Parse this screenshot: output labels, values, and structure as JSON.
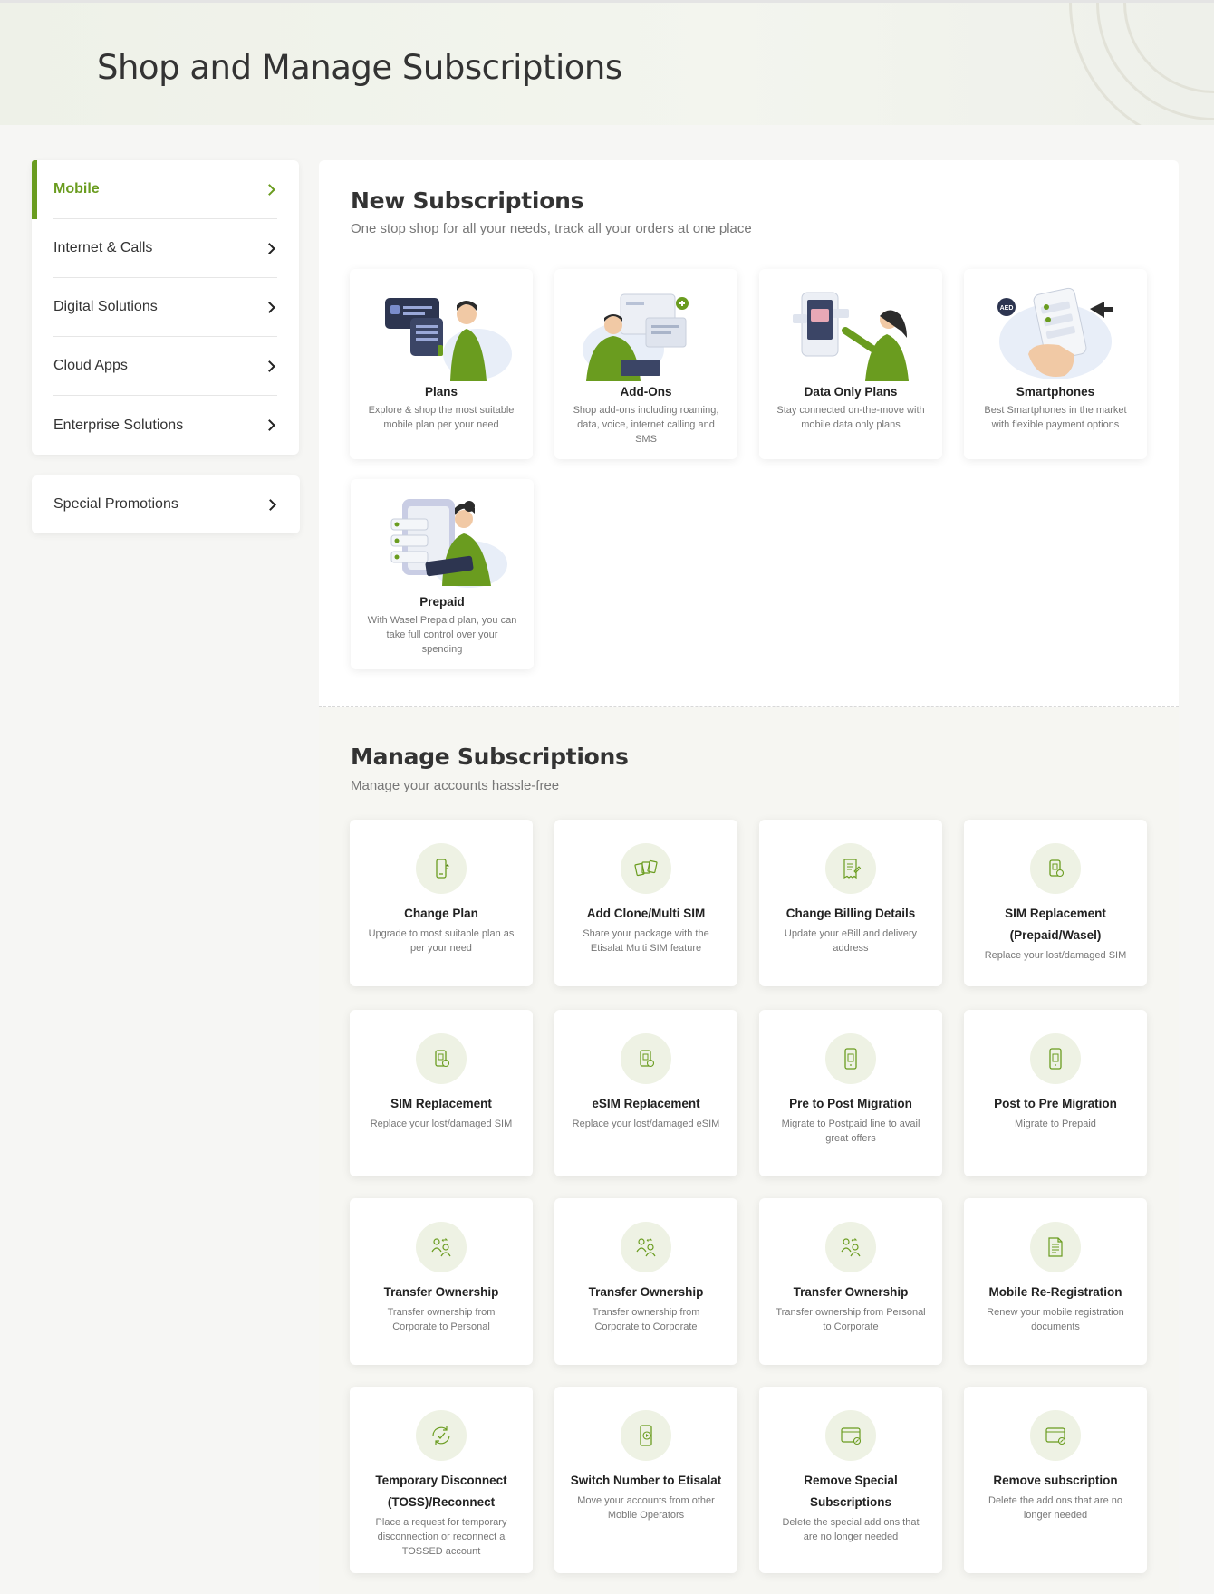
{
  "header": {
    "title": "Shop and Manage Subscriptions"
  },
  "sidebar": {
    "items": [
      {
        "label": "Mobile"
      },
      {
        "label": "Internet & Calls"
      },
      {
        "label": "Digital Solutions"
      },
      {
        "label": "Cloud Apps"
      },
      {
        "label": "Enterprise Solutions"
      }
    ],
    "promo": {
      "label": "Special Promotions"
    }
  },
  "new_subscriptions": {
    "title": "New Subscriptions",
    "subtitle": "One stop shop for all your needs, track all your orders at one place",
    "cards": [
      {
        "title": "Plans",
        "desc": "Explore & shop the most suitable mobile plan per your need",
        "icon": "plans-illustration"
      },
      {
        "title": "Add-Ons",
        "desc": "Shop add-ons including roaming, data, voice, internet calling and SMS",
        "icon": "addons-illustration"
      },
      {
        "title": "Data Only Plans",
        "desc": "Stay connected on-the-move with mobile data only plans",
        "icon": "data-plans-illustration"
      },
      {
        "title": "Smartphones",
        "desc": "Best Smartphones in the market with flexible payment options",
        "icon": "smartphones-illustration",
        "badge": "AED"
      },
      {
        "title": "Prepaid",
        "desc": "With Wasel Prepaid plan, you can take full control over your spending",
        "icon": "prepaid-illustration"
      }
    ]
  },
  "manage_subscriptions": {
    "title": "Manage Subscriptions",
    "subtitle": "Manage your accounts hassle-free",
    "cards": [
      {
        "title": "Change Plan",
        "desc": "Upgrade to most suitable plan as per your need",
        "icon": "phone-icon"
      },
      {
        "title": "Add Clone/Multi SIM",
        "desc": "Share your package with the Etisalat Multi SIM feature",
        "icon": "multi-sim-icon"
      },
      {
        "title": "Change Billing Details",
        "desc": "Update your eBill and delivery address",
        "icon": "bill-icon"
      },
      {
        "title": "SIM Replacement (Prepaid/Wasel)",
        "desc": "Replace your lost/damaged SIM",
        "icon": "sim-icon"
      },
      {
        "title": "SIM Replacement",
        "desc": "Replace your lost/damaged SIM",
        "icon": "sim-icon"
      },
      {
        "title": "eSIM Replacement",
        "desc": "Replace your lost/damaged eSIM",
        "icon": "sim-icon"
      },
      {
        "title": "Pre to Post Migration",
        "desc": "Migrate to Postpaid line to avail great offers",
        "icon": "phone-migrate-icon"
      },
      {
        "title": "Post to Pre Migration",
        "desc": "Migrate to Prepaid",
        "icon": "phone-migrate-icon"
      },
      {
        "title": "Transfer Ownership",
        "desc": "Transfer ownership from Corporate to Personal",
        "icon": "users-icon"
      },
      {
        "title": "Transfer Ownership",
        "desc": "Transfer ownership from Corporate to Corporate",
        "icon": "users-icon"
      },
      {
        "title": "Transfer Ownership",
        "desc": "Transfer ownership from Personal to Corporate",
        "icon": "users-icon"
      },
      {
        "title": "Mobile Re-Registration",
        "desc": "Renew your mobile registration documents",
        "icon": "document-icon"
      },
      {
        "title": "Temporary Disconnect (TOSS)/Reconnect",
        "desc": "Place a request for temporary disconnection or reconnect a TOSSED account",
        "icon": "refresh-check-icon"
      },
      {
        "title": "Switch Number to Etisalat",
        "desc": "Move your accounts from other Mobile Operators",
        "icon": "phone-switch-icon"
      },
      {
        "title": "Remove Special Subscriptions",
        "desc": "Delete the special add ons that are no longer needed",
        "icon": "window-remove-icon"
      },
      {
        "title": "Remove subscription",
        "desc": "Delete the add ons that are no longer needed",
        "icon": "window-remove-icon"
      }
    ]
  },
  "colors": {
    "accent": "#6a9c1f",
    "icon_bg": "#eef2e4"
  }
}
